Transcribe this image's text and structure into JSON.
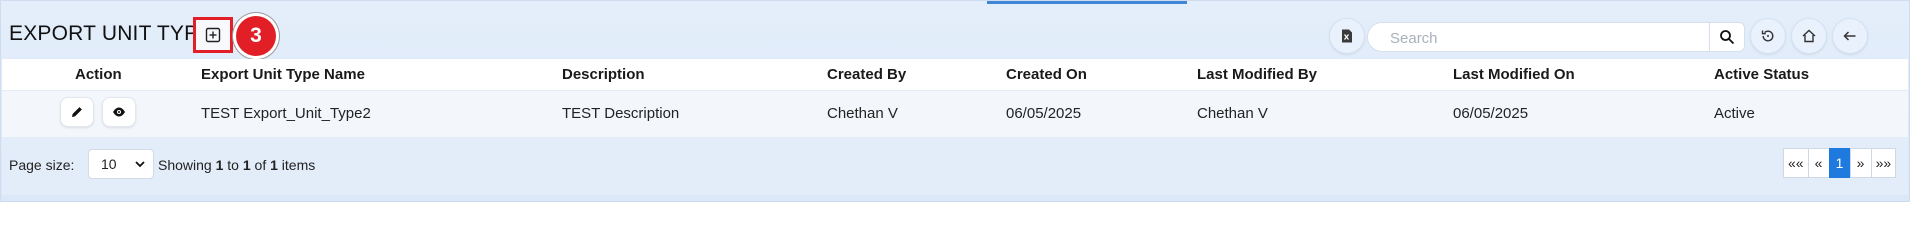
{
  "header": {
    "title": "EXPORT UNIT TYPE",
    "annotation_number": "3",
    "search_placeholder": "Search"
  },
  "icons": {
    "add": "add-square-icon",
    "excel": "excel-export-icon",
    "search": "search-icon",
    "reset": "reset-icon",
    "home": "home-icon",
    "back": "back-arrow-icon",
    "edit": "pencil-icon",
    "view": "eye-icon"
  },
  "colors": {
    "accent": "#1f7ae0",
    "annotation": "#e21f26",
    "header_bg": "#dbe8f8"
  },
  "table": {
    "columns": [
      "Action",
      "Export Unit Type Name",
      "Description",
      "Created By",
      "Created On",
      "Last Modified By",
      "Last Modified On",
      "Active Status"
    ],
    "rows": [
      {
        "name": "TEST Export_Unit_Type2",
        "description": "TEST Description",
        "created_by": "Chethan V",
        "created_on": "06/05/2025",
        "modified_by": "Chethan V",
        "modified_on": "06/05/2025",
        "status": "Active"
      }
    ]
  },
  "footer": {
    "page_size_label": "Page size:",
    "page_size_value": "10",
    "showing_prefix": "Showing ",
    "showing_from": "1",
    "showing_to_word": " to ",
    "showing_to": "1",
    "showing_of_word": " of ",
    "showing_total": "1",
    "showing_suffix": " items",
    "pager": {
      "first": "««",
      "prev": "«",
      "current": "1",
      "next": "»",
      "last": "»»"
    }
  }
}
